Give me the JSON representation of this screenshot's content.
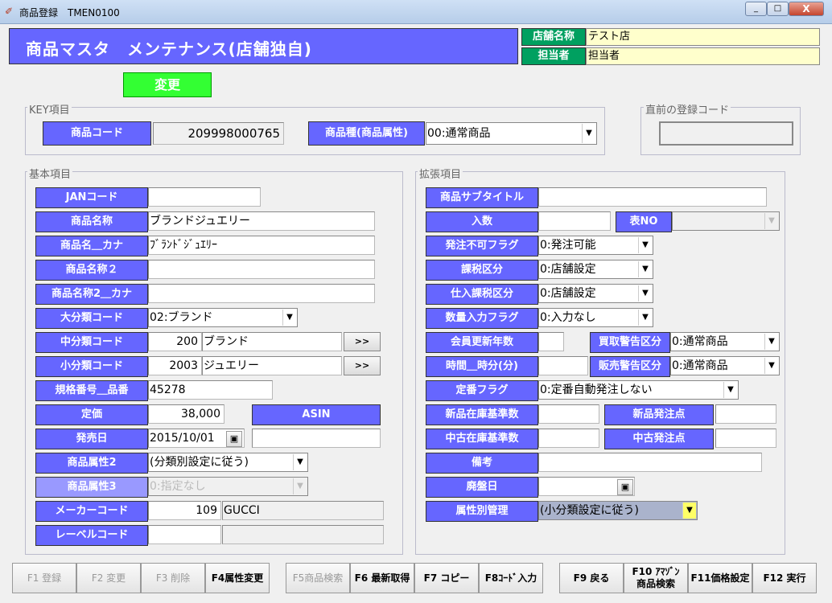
{
  "window": {
    "title": "商品登録　TMEN0100",
    "min": "_",
    "max": "□",
    "close": "X"
  },
  "header": {
    "title": "商品マスタ　メンテナンス(店舗独自)",
    "store_label": "店舗名称",
    "store_value": "テスト店",
    "staff_label": "担当者",
    "staff_value": "担当者"
  },
  "mode_button": "変更",
  "key": {
    "group": "KEY項目",
    "code_label": "商品コード",
    "code_value": "209998000765",
    "type_label": "商品種(商品属性)",
    "type_value": "00:通常商品"
  },
  "prev": {
    "group": "直前の登録コード",
    "value": ""
  },
  "basic": {
    "group": "基本項目",
    "jan_label": "JANコード",
    "jan_value": "",
    "name_label": "商品名称",
    "name_value": "ブランドジュエリー",
    "kana_label": "商品名＿カナ",
    "kana_value": "ﾌﾞﾗﾝﾄﾞｼﾞｭｴﾘｰ",
    "name2_label": "商品名称２",
    "name2_value": "",
    "kana2_label": "商品名称2＿カナ",
    "kana2_value": "",
    "major_label": "大分類コード",
    "major_value": "02:ブランド",
    "mid_label": "中分類コード",
    "mid_code": "200",
    "mid_name": "ブランド",
    "mid_btn": ">>",
    "minor_label": "小分類コード",
    "minor_code": "2003",
    "minor_name": "ジュエリー",
    "minor_btn": ">>",
    "spec_label": "規格番号＿品番",
    "spec_value": "45278",
    "price_label": "定価",
    "price_value": "38,000",
    "asin_label": "ASIN",
    "asin_value": "",
    "release_label": "発売日",
    "release_value": "2015/10/01",
    "release_extra": "",
    "attr2_label": "商品属性2",
    "attr2_value": "(分類別設定に従う)",
    "attr3_label": "商品属性3",
    "attr3_value": "0:指定なし",
    "maker_label": "メーカーコード",
    "maker_code": "109",
    "maker_name": "GUCCI",
    "label_label": "レーベルコード",
    "label_code": "",
    "label_name": ""
  },
  "ext": {
    "group": "拡張項目",
    "subtitle_label": "商品サブタイトル",
    "subtitle_value": "",
    "qty_label": "入数",
    "qty_value": "",
    "tbl_label": "表NO",
    "tbl_value": "",
    "noorder_label": "発注不可フラグ",
    "noorder_value": "0:発注可能",
    "tax_label": "課税区分",
    "tax_value": "0:店舗設定",
    "ptax_label": "仕入課税区分",
    "ptax_value": "0:店舗設定",
    "qtyflag_label": "数量入力フラグ",
    "qtyflag_value": "0:入力なし",
    "member_label": "会員更新年数",
    "member_value": "",
    "buywarn_label": "買取警告区分",
    "buywarn_value": "0:通常商品",
    "time_label": "時間＿時分(分)",
    "time_value": "",
    "sellwarn_label": "販売警告区分",
    "sellwarn_value": "0:通常商品",
    "fixed_label": "定番フラグ",
    "fixed_value": "0:定番自動発注しない",
    "newstock_label": "新品在庫基準数",
    "newstock_value": "",
    "neworder_label": "新品発注点",
    "neworder_value": "",
    "usedstock_label": "中古在庫基準数",
    "usedstock_value": "",
    "usedorder_label": "中古発注点",
    "usedorder_value": "",
    "memo_label": "備考",
    "memo_value": "",
    "discont_label": "廃盤日",
    "discont_value": "",
    "attrmgmt_label": "属性別管理",
    "attrmgmt_value": "(小分類設定に従う)"
  },
  "fkeys": [
    "F1 登録",
    "F2 変更",
    "F3 削除",
    "F4属性変更",
    "F5商品検索",
    "F6 最新取得",
    "F7 コピー",
    "F8ｺｰﾄﾞ入力",
    "F9 戻る",
    "F10 ｱﾏｿﾞﾝ",
    "商品検索",
    "F11価格設定",
    "F12 実行"
  ]
}
